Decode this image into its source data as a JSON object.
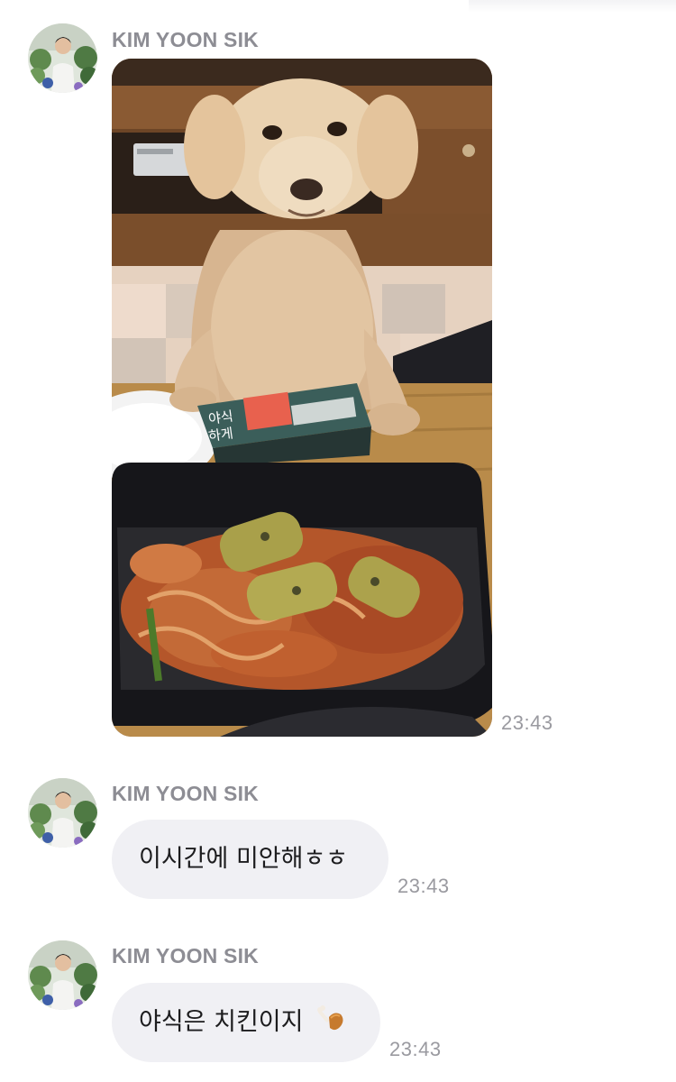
{
  "messages": [
    {
      "sender": "KIM YOON SIK",
      "type": "image",
      "image_description": "dog-with-food-photo",
      "package_label": "야식\n하게",
      "time": "23:43"
    },
    {
      "sender": "KIM YOON SIK",
      "type": "text",
      "text": "이시간에 미안해ㅎㅎ",
      "time": "23:43"
    },
    {
      "sender": "KIM YOON SIK",
      "type": "text",
      "text": "야식은 치킨이지",
      "emoji": "chicken-leg-icon",
      "time": "23:43"
    }
  ],
  "colors": {
    "bubble": "#f0f0f4",
    "sender": "#8d8d94",
    "time": "#9a9aa0",
    "text": "#1c1c1e"
  }
}
